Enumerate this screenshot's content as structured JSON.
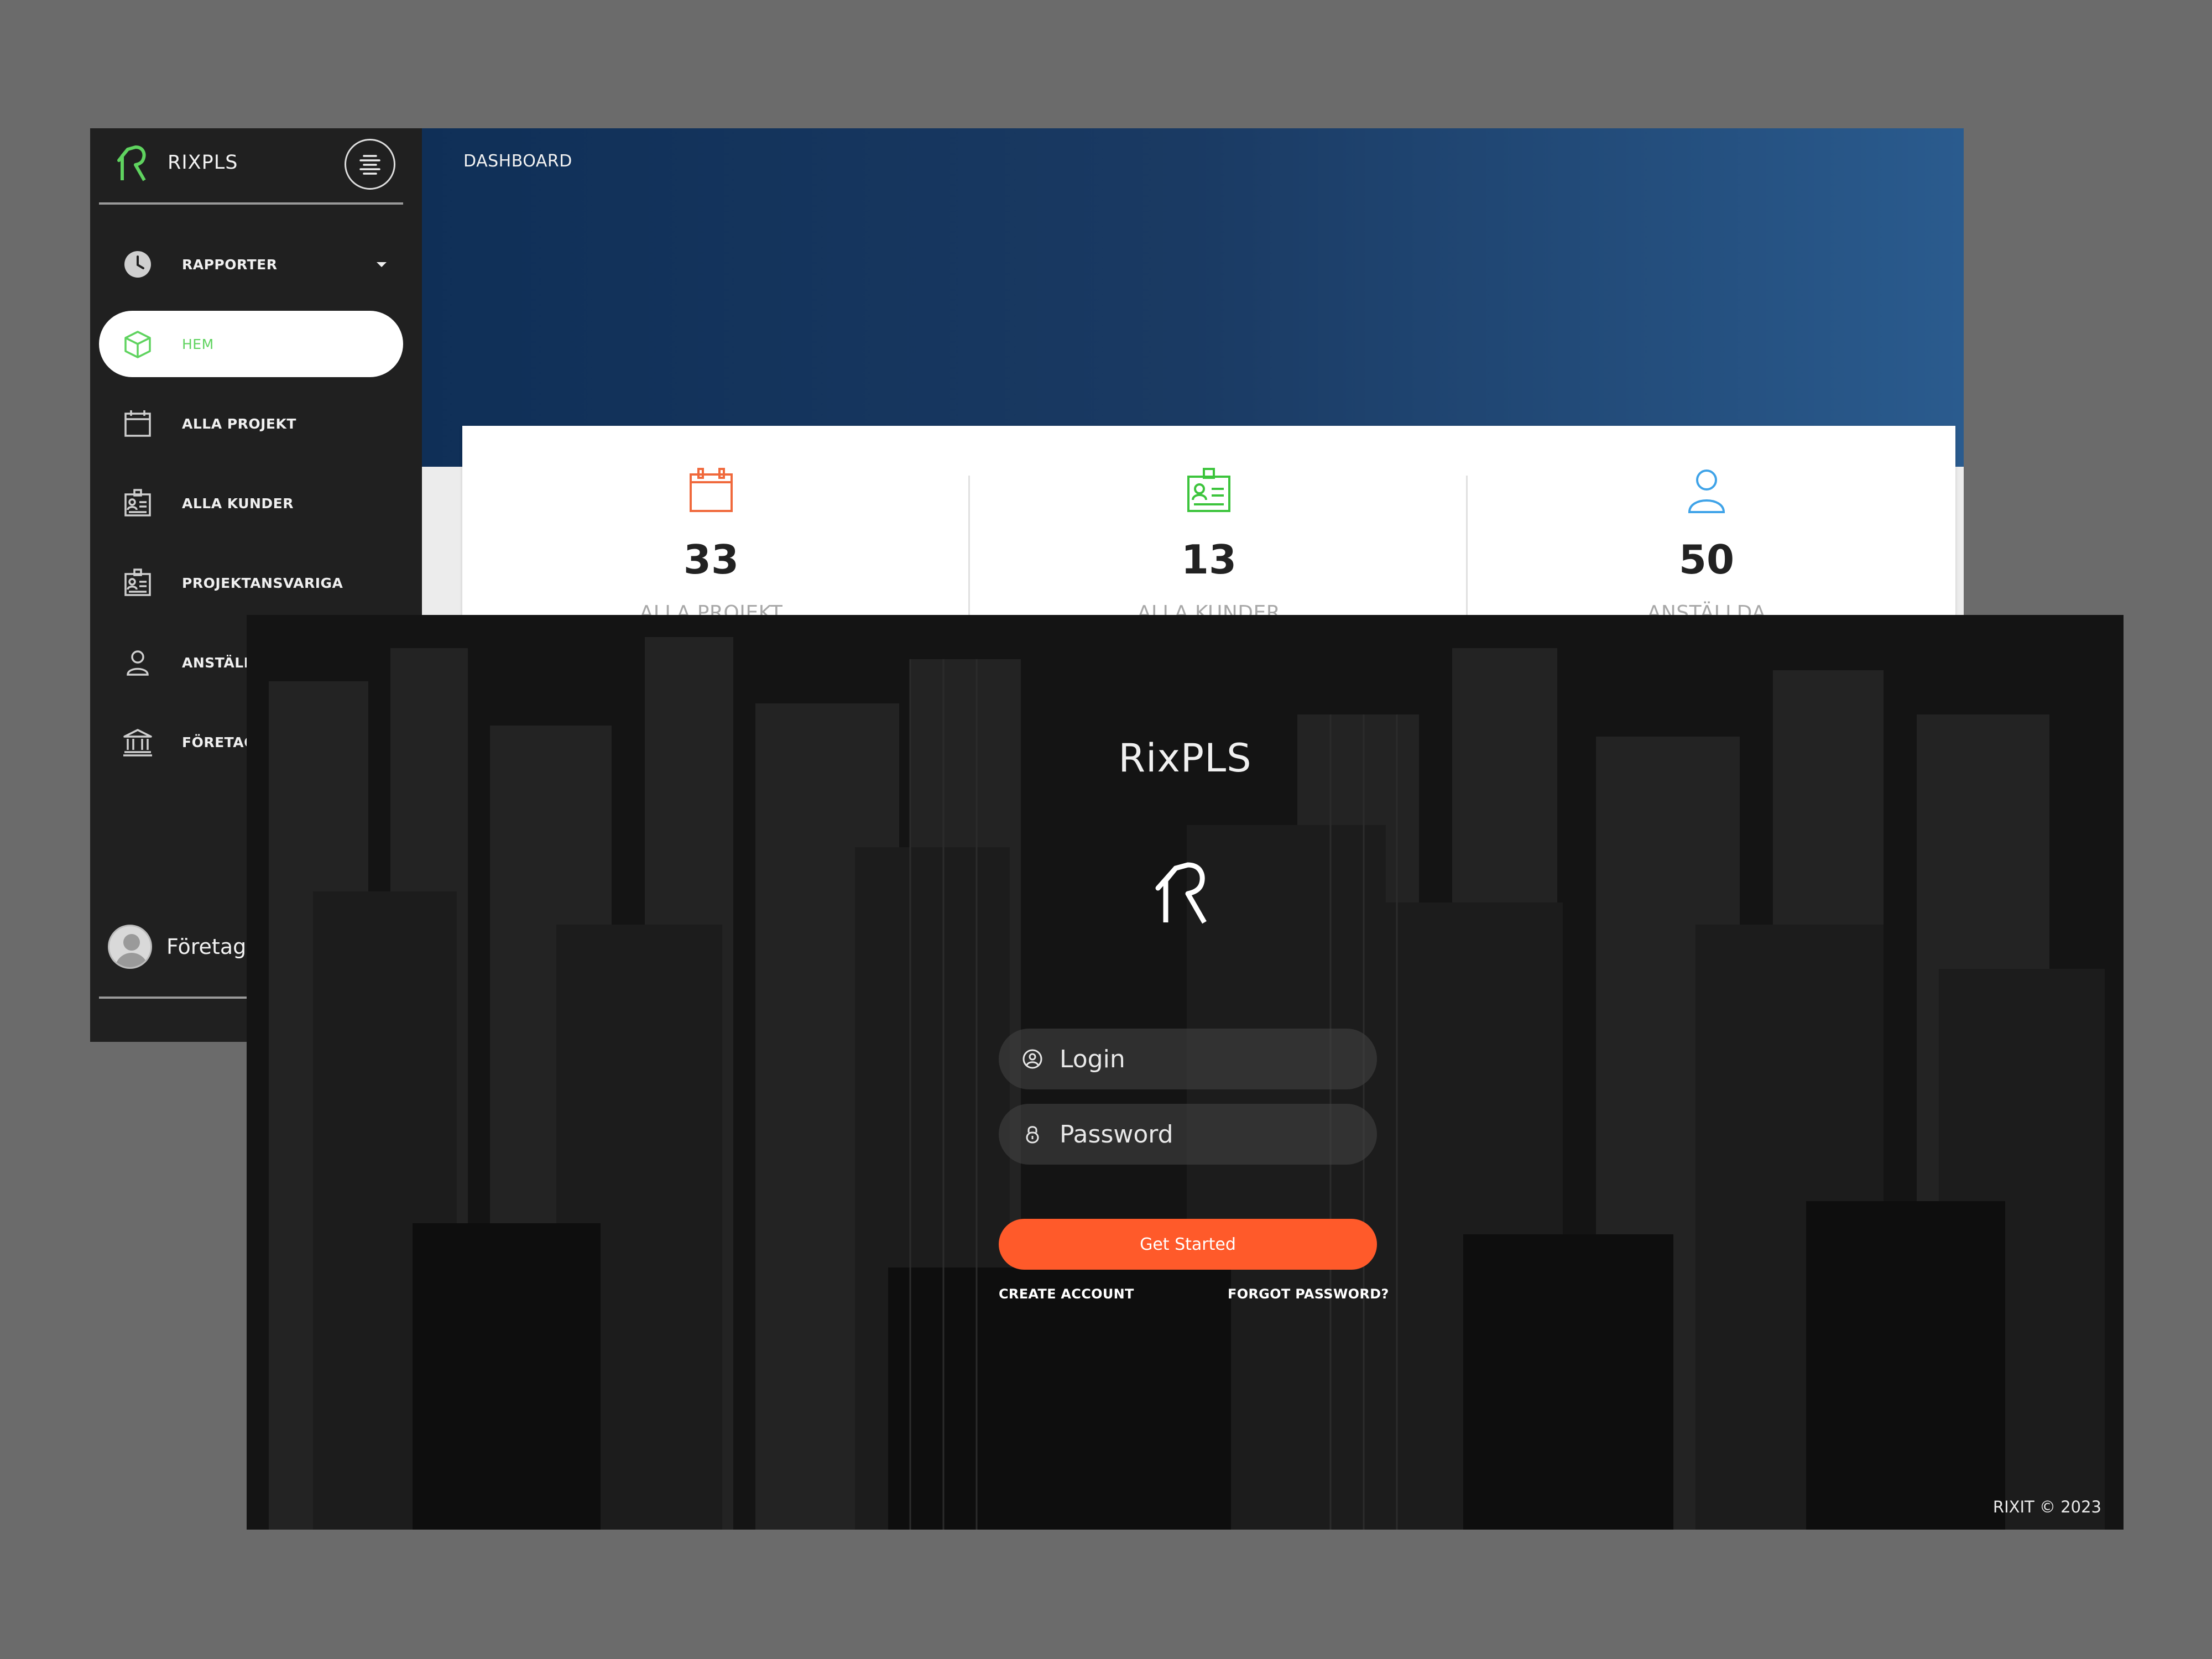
{
  "dashboard": {
    "brand": "RIXPLS",
    "nav": [
      {
        "label": "RAPPORTER",
        "icon": "clock-icon",
        "active": false,
        "has_caret": true
      },
      {
        "label": "HEM",
        "icon": "cube-icon",
        "active": true
      },
      {
        "label": "ALLA PROJEKT",
        "icon": "calendar-icon",
        "active": false
      },
      {
        "label": "ALLA KUNDER",
        "icon": "id-card-icon",
        "active": false
      },
      {
        "label": "PROJEKTANSVARIGA",
        "icon": "id-card-icon",
        "active": false
      },
      {
        "label": "ANSTÄLLDA",
        "icon": "user-icon",
        "active": false
      },
      {
        "label": "FÖRETAG",
        "icon": "bank-icon",
        "active": false
      }
    ],
    "user": {
      "name": "Företags"
    },
    "page_title": "DASHBOARD",
    "stats": [
      {
        "value": "33",
        "label": "ALLA PROJEKT",
        "icon": "calendar-icon",
        "color": "#f0693c"
      },
      {
        "value": "13",
        "label": "ALLA KUNDER",
        "icon": "id-card-icon",
        "color": "#3cc43c"
      },
      {
        "value": "50",
        "label": "ANSTÄLLDA",
        "icon": "user-icon",
        "color": "#3fa3e8"
      }
    ],
    "colors": {
      "accent_green": "#5fd35f",
      "sidebar": "#202020"
    }
  },
  "login": {
    "title": "RixPLS",
    "login_placeholder": "Login",
    "password_placeholder": "Password",
    "submit_label": "Get Started",
    "create_account": "CREATE ACCOUNT",
    "forgot_password": "FORGOT PASSWORD?",
    "footer": "RIXIT © 2023",
    "colors": {
      "button": "#ff5a2a"
    }
  }
}
